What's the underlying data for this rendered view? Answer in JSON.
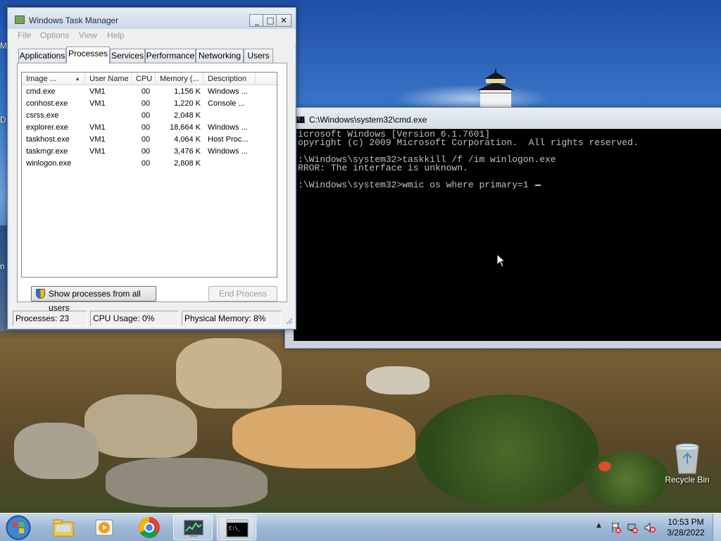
{
  "desktop": {
    "edge_letters": [
      "M",
      "D",
      "n"
    ],
    "recycle_bin_label": "Recycle Bin"
  },
  "cmd": {
    "title": "C:\\Windows\\system32\\cmd.exe",
    "lines": [
      "icrosoft Windows [Version 6.1.7601]",
      "opyright (c) 2009 Microsoft Corporation.  All rights reserved.",
      "",
      ":\\Windows\\system32>taskkill /f /im winlogon.exe",
      "RROR: The interface is unknown.",
      "",
      ":\\Windows\\system32>wmic os where primary=1 "
    ]
  },
  "taskmgr": {
    "title": "Windows Task Manager",
    "menu": [
      "File",
      "Options",
      "View",
      "Help"
    ],
    "tabs": [
      "Applications",
      "Processes",
      "Services",
      "Performance",
      "Networking",
      "Users"
    ],
    "active_tab": "Processes",
    "columns": [
      "Image ...",
      "User Name",
      "CPU",
      "Memory (...",
      "Description"
    ],
    "processes": [
      {
        "image": "cmd.exe",
        "user": "VM1",
        "cpu": "00",
        "memory": "1,156 K",
        "desc": "Windows ..."
      },
      {
        "image": "conhost.exe",
        "user": "VM1",
        "cpu": "00",
        "memory": "1,220 K",
        "desc": "Console ..."
      },
      {
        "image": "csrss.exe",
        "user": "",
        "cpu": "00",
        "memory": "2,048 K",
        "desc": ""
      },
      {
        "image": "explorer.exe",
        "user": "VM1",
        "cpu": "00",
        "memory": "18,664 K",
        "desc": "Windows ..."
      },
      {
        "image": "taskhost.exe",
        "user": "VM1",
        "cpu": "00",
        "memory": "4,064 K",
        "desc": "Host Proc..."
      },
      {
        "image": "taskmgr.exe",
        "user": "VM1",
        "cpu": "00",
        "memory": "3,476 K",
        "desc": "Windows ..."
      },
      {
        "image": "winlogon.exe",
        "user": "",
        "cpu": "00",
        "memory": "2,808 K",
        "desc": ""
      }
    ],
    "buttons": {
      "show_all": "Show processes from all users",
      "end_process": "End Process"
    },
    "status": {
      "processes": "Processes: 23",
      "cpu": "CPU Usage: 0%",
      "memory": "Physical Memory: 8%"
    },
    "window_buttons": {
      "minimize": "_",
      "maximize": "□",
      "close": "✕"
    }
  },
  "taskbar": {
    "clock_time": "10:53 PM",
    "clock_date": "3/28/2022",
    "pinned": [
      "start-orb",
      "file-explorer-icon",
      "media-player-icon",
      "chrome-icon",
      "task-manager-icon",
      "cmd-icon"
    ]
  },
  "colors": {
    "cmd_bg": "#000000",
    "cmd_text": "#c0c0c0",
    "window_frame": "#cfdbe9",
    "taskbar": "#a9c1dc"
  }
}
